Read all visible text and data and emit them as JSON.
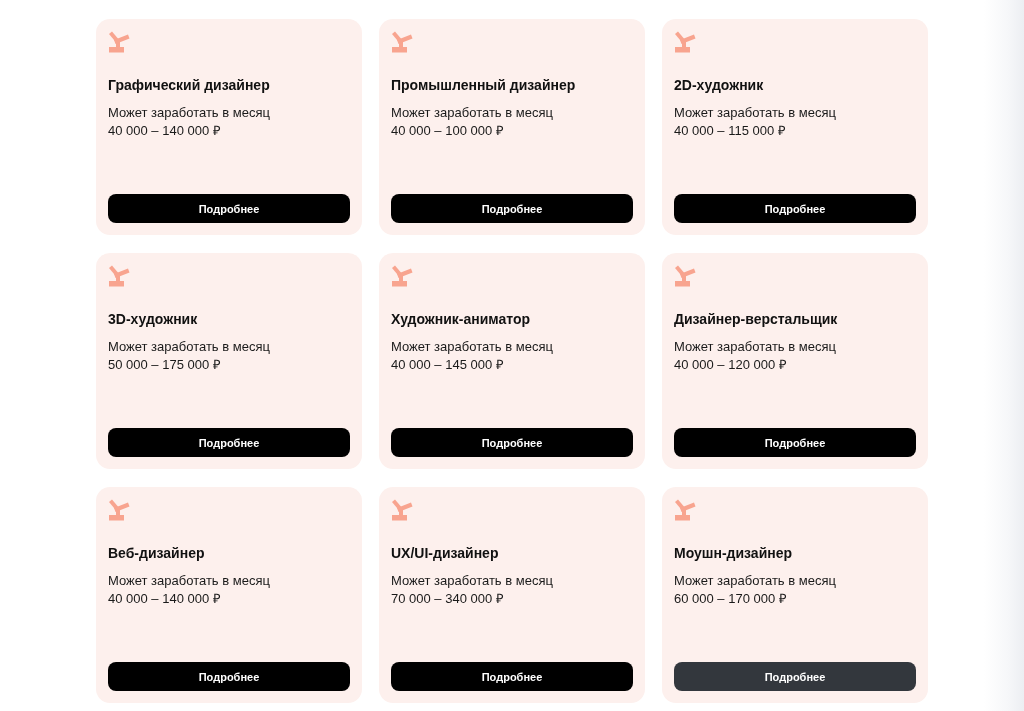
{
  "cards": [
    {
      "title": "Графический дизайнер",
      "caption": "Может заработать в месяц",
      "salary": "40 000 – 140 000 ₽",
      "button": {
        "label": "Подробнее",
        "hovered": false
      }
    },
    {
      "title": "Промышленный дизайнер",
      "caption": "Может заработать в месяц",
      "salary": "40 000 – 100 000 ₽",
      "button": {
        "label": "Подробнее",
        "hovered": false
      }
    },
    {
      "title": "2D-художник",
      "caption": "Может заработать в месяц",
      "salary": "40 000 – 115 000 ₽",
      "button": {
        "label": "Подробнее",
        "hovered": false
      }
    },
    {
      "title": "3D-художник",
      "caption": "Может заработать в месяц",
      "salary": "50 000 – 175 000 ₽",
      "button": {
        "label": "Подробнее",
        "hovered": false
      }
    },
    {
      "title": "Художник-аниматор",
      "caption": "Может заработать в месяц",
      "salary": "40 000 – 145 000 ₽",
      "button": {
        "label": "Подробнее",
        "hovered": false
      }
    },
    {
      "title": "Дизайнер-верстальщик",
      "caption": "Может заработать в месяц",
      "salary": "40 000 – 120 000 ₽",
      "button": {
        "label": "Подробнее",
        "hovered": false
      }
    },
    {
      "title": "Веб-дизайнер",
      "caption": "Может заработать в месяц",
      "salary": "40 000 – 140 000 ₽",
      "button": {
        "label": "Подробнее",
        "hovered": false
      }
    },
    {
      "title": "UX/UI-дизайнер",
      "caption": "Может заработать в месяц",
      "salary": "70 000 – 340 000 ₽",
      "button": {
        "label": "Подробнее",
        "hovered": false
      }
    },
    {
      "title": "Моушн-дизайнер",
      "caption": "Может заработать в месяц",
      "salary": "60 000 – 170 000 ₽",
      "button": {
        "label": "Подробнее",
        "hovered": true
      }
    }
  ]
}
